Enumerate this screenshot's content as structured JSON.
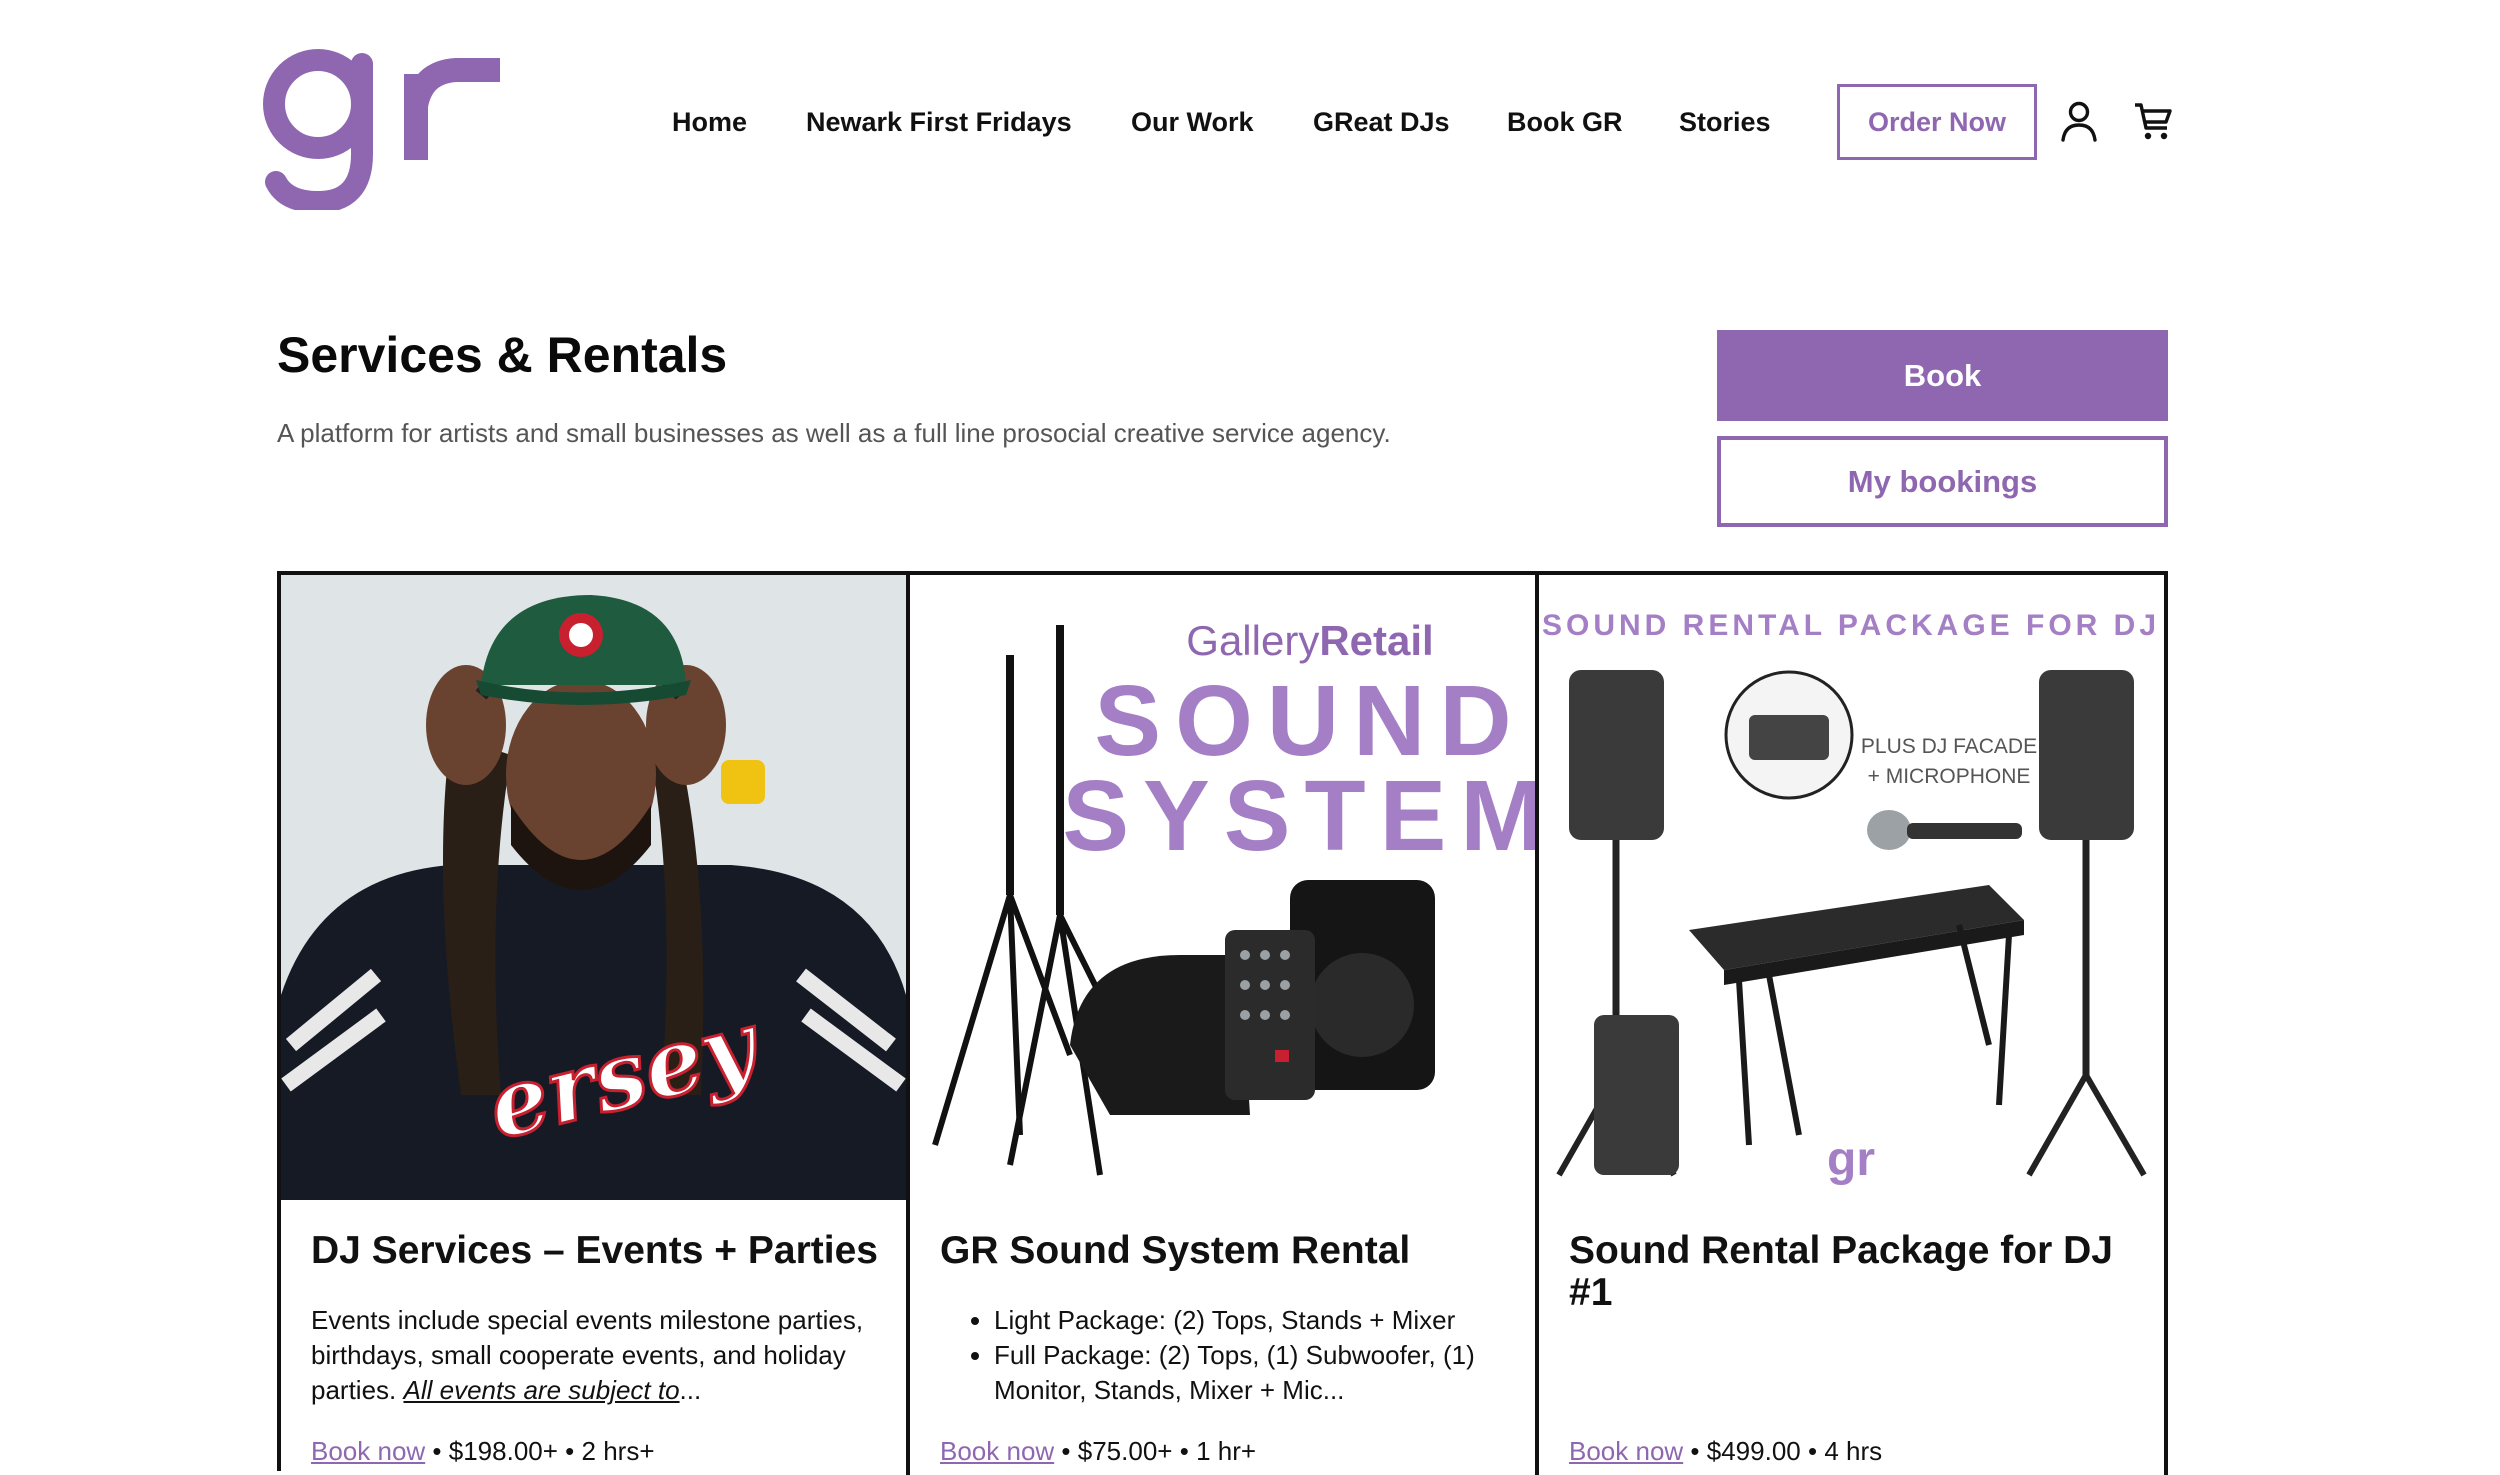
{
  "brand": {
    "logo_text": "gr",
    "accent": "#8f67b0"
  },
  "nav": {
    "items": [
      "Home",
      "Newark First Fridays",
      "Our Work",
      "GReat DJs",
      "Book GR",
      "Stories"
    ],
    "order_button": "Order Now",
    "account_icon": "user-icon",
    "cart_icon": "cart-icon"
  },
  "intro": {
    "title": "Services & Rentals",
    "subtitle": "A platform for artists and small businesses as well as a full line prosocial creative service agency.",
    "book_button": "Book",
    "my_bookings_button": "My bookings"
  },
  "cards": [
    {
      "title": "DJ Services – Events + Parties",
      "desc_plain": "Events include special events milestone parties, birthdays, small cooperate events, and holiday parties. ",
      "desc_link": "All events are subject to",
      "desc_ellipsis": "...",
      "cta": "Book now",
      "price": "$198.00+",
      "duration": "2 hrs+"
    },
    {
      "title": "GR Sound System Rental",
      "bullets": [
        "Light Package: (2) Tops, Stands + Mixer",
        "Full Package: (2) Tops, (1) Subwoofer, (1) Monitor, Stands, Mixer + Mic..."
      ],
      "image_text": {
        "brand_a": "Gallery",
        "brand_b": "Retail",
        "line1": "SOUND",
        "line2": "SYSTEM"
      },
      "cta": "Book now",
      "price": "$75.00+",
      "duration": "1 hr+"
    },
    {
      "title": "Sound Rental Package for DJ #1",
      "image_text": {
        "heading": "SOUND RENTAL PACKAGE FOR DJ",
        "facade_1": "PLUS DJ FACADE",
        "facade_2": "+ MICROPHONE",
        "mark": "gr"
      },
      "cta": "Book now",
      "price": "$499.00",
      "duration": "4 hrs"
    }
  ],
  "separator": "•"
}
